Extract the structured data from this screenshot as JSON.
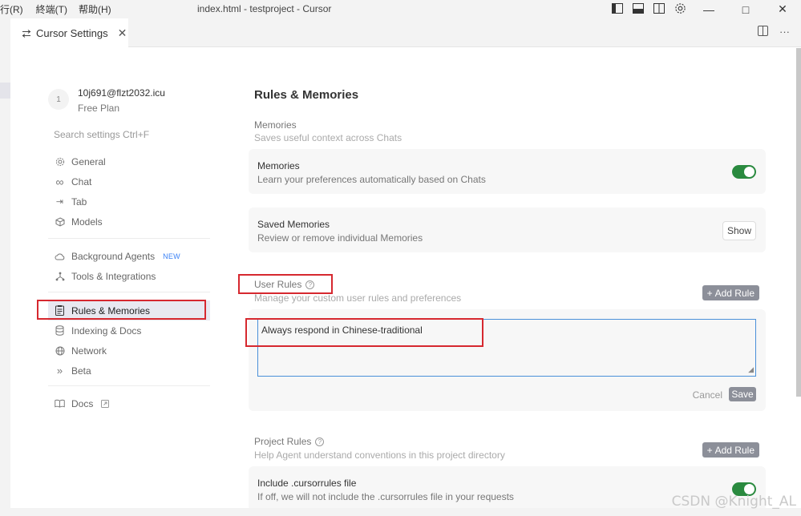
{
  "titlebar": {
    "menu": [
      "行(R)",
      "終端(T)",
      "帮助(H)"
    ],
    "window_title": "index.html - testproject - Cursor",
    "controls": {
      "minimize": "—",
      "maximize": "□",
      "close": "✕"
    }
  },
  "tab": {
    "label": "Cursor Settings"
  },
  "sidebar": {
    "account": {
      "avatar_initial": "1",
      "email": "10j691@flzt2032.icu",
      "plan": "Free Plan"
    },
    "search_placeholder": "Search settings Ctrl+F",
    "group1": [
      {
        "label": "General",
        "icon": "gear-icon"
      },
      {
        "label": "Chat",
        "icon": "infinity-icon"
      },
      {
        "label": "Tab",
        "icon": "tab-arrow-icon"
      },
      {
        "label": "Models",
        "icon": "cube-icon"
      }
    ],
    "group2": [
      {
        "label": "Background Agents",
        "icon": "cloud-icon",
        "badge": "NEW"
      },
      {
        "label": "Tools & Integrations",
        "icon": "nodes-icon"
      }
    ],
    "group3": [
      {
        "label": "Rules & Memories",
        "icon": "document-icon",
        "active": true
      },
      {
        "label": "Indexing & Docs",
        "icon": "database-icon"
      },
      {
        "label": "Network",
        "icon": "globe-icon"
      },
      {
        "label": "Beta",
        "icon": "chevrons-icon"
      }
    ],
    "group4": [
      {
        "label": "Docs",
        "icon": "book-icon"
      }
    ]
  },
  "main": {
    "title": "Rules & Memories",
    "memories_section": {
      "title": "Memories",
      "subtitle": "Saves useful context across Chats"
    },
    "memories_card": {
      "title": "Memories",
      "subtitle": "Learn your preferences automatically based on Chats",
      "enabled": true
    },
    "saved_memories_card": {
      "title": "Saved Memories",
      "subtitle": "Review or remove individual Memories",
      "button": "Show"
    },
    "user_rules": {
      "title": "User Rules",
      "subtitle": "Manage your custom user rules and preferences",
      "add_button": "Add Rule",
      "rule_text": "Always respond in Chinese-traditional",
      "cancel": "Cancel",
      "save": "Save"
    },
    "project_rules": {
      "title": "Project Rules",
      "subtitle": "Help Agent understand conventions in this project directory",
      "add_button": "Add Rule"
    },
    "cursorrules_card": {
      "title": "Include .cursorrules file",
      "subtitle": "If off, we will not include the .cursorrules file in your requests",
      "enabled": true
    }
  },
  "watermark": "CSDN @Knight_AL",
  "colors": {
    "toggle_on": "#2a8a3f",
    "highlight_box": "#d6282f",
    "input_focus": "#4a90d9"
  }
}
